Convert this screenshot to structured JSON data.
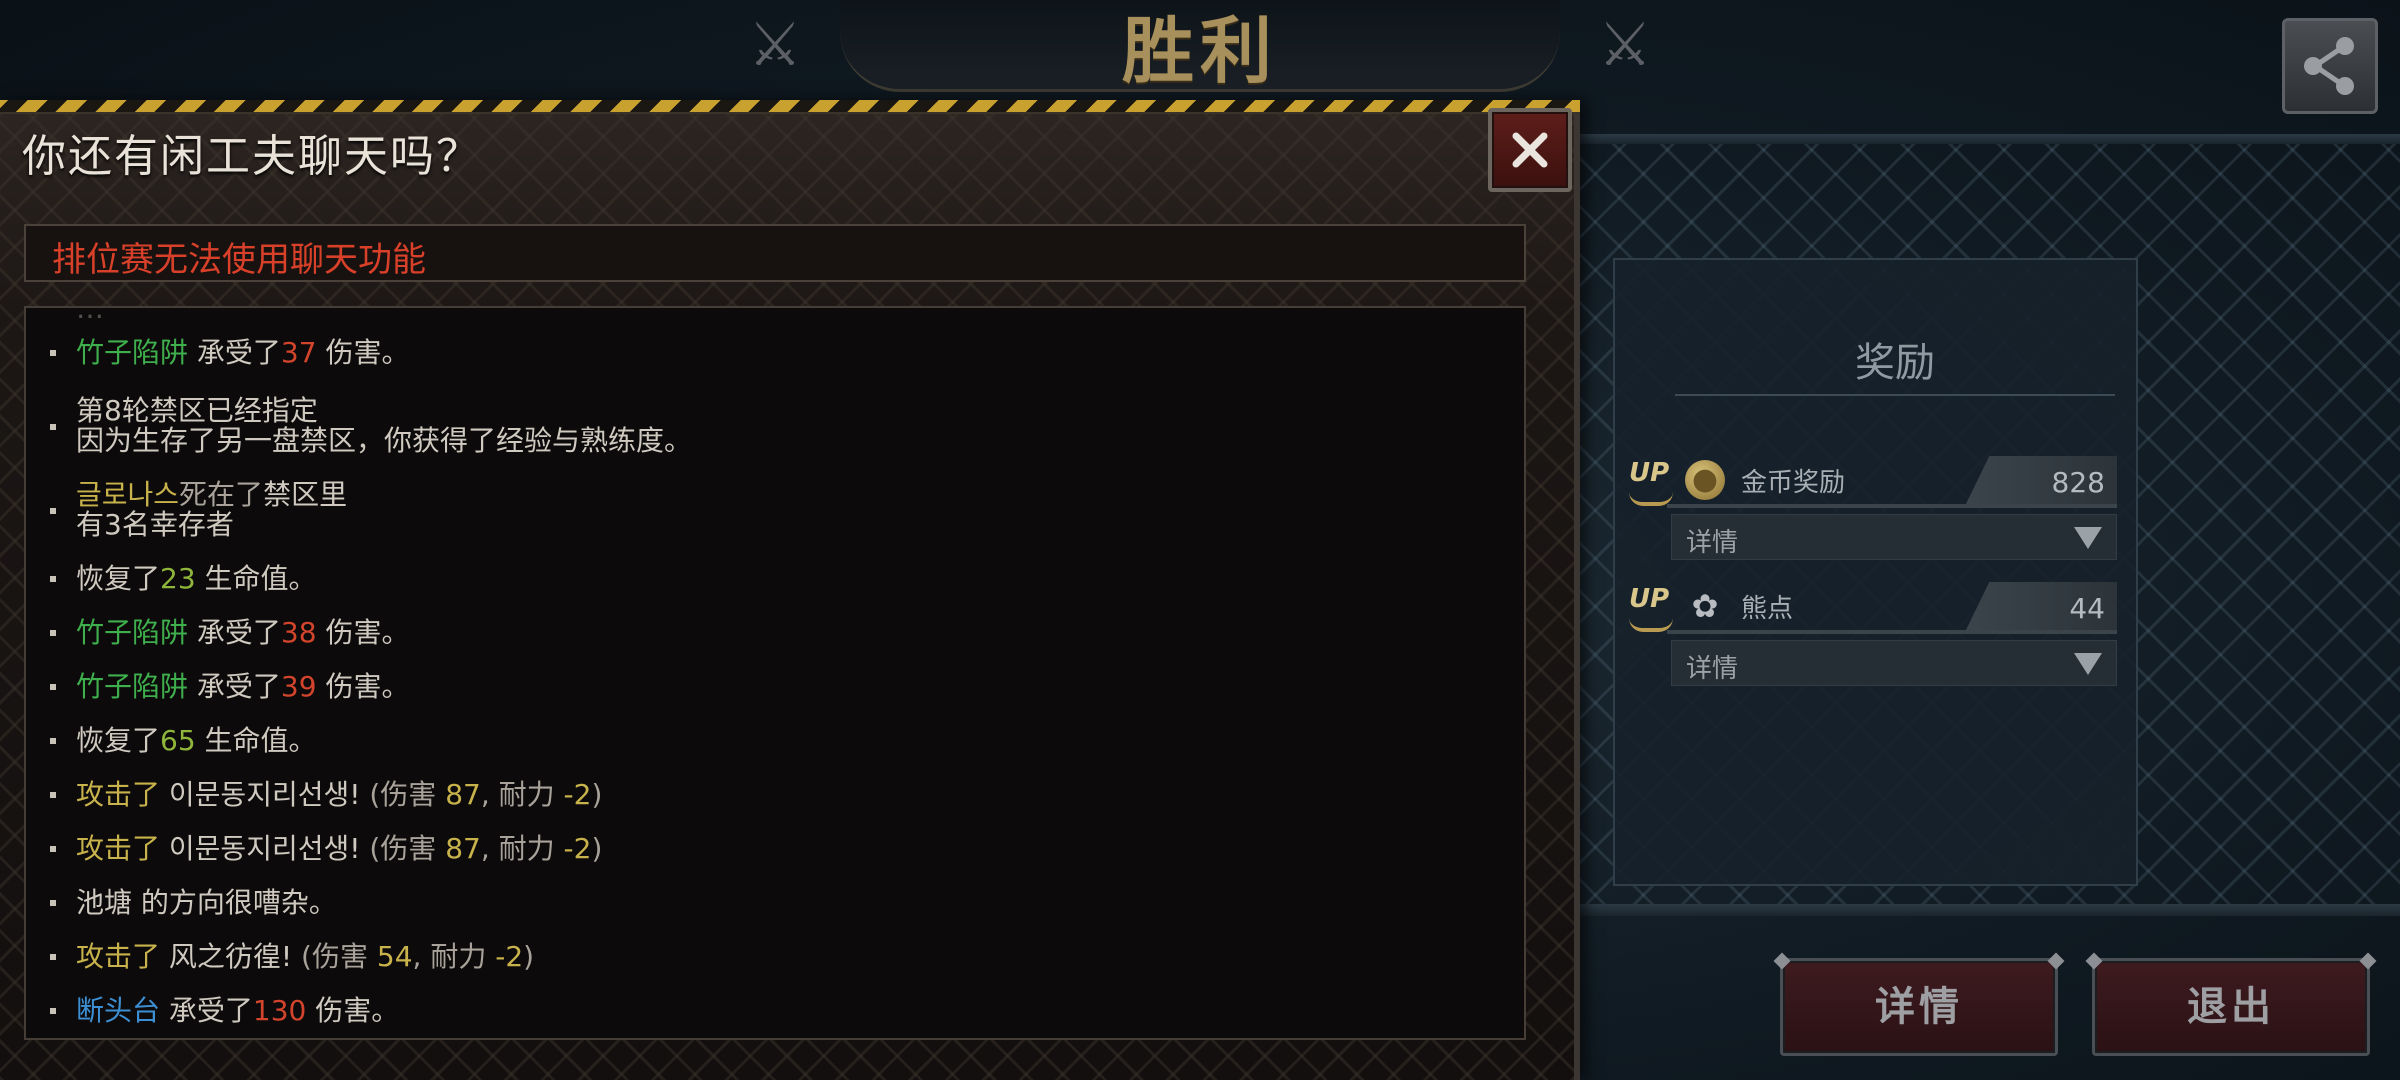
{
  "victory_title": "胜利",
  "chat_dialog": {
    "title": "你还有闲工夫聊天吗？",
    "notice": "排位赛无法使用聊天功能",
    "close_label": "✕"
  },
  "log_cutoff_text": "…",
  "log": [
    {
      "who": "竹子陷阱",
      "mid": " 承受了",
      "num": "37",
      "end": " 伤害。"
    },
    {
      "line1": "第8轮禁区已经指定",
      "line2": "因为生存了另一盘禁区，你获得了经验与熟练度。"
    },
    {
      "who": "글로나스",
      "mid": "死在了",
      "end": "禁区里",
      "line2": "有3名幸存者"
    },
    {
      "pre": "恢复了",
      "num": "23",
      "end": " 生命值。"
    },
    {
      "who": "竹子陷阱",
      "mid": " 承受了",
      "num": "38",
      "end": " 伤害。"
    },
    {
      "who": "竹子陷阱",
      "mid": " 承受了",
      "num": "39",
      "end": " 伤害。"
    },
    {
      "pre": "恢复了",
      "num": "65",
      "end": " 生命值。"
    },
    {
      "act": "攻击了",
      "target": " 이문동지리선생!",
      "p1": " (伤害 ",
      "dmg": "87",
      "p2": ",  耐力  ",
      "dur": "-2",
      "p3": ")"
    },
    {
      "act": "攻击了",
      "target": " 이문동지리선생!",
      "p1": " (伤害 ",
      "dmg": "87",
      "p2": ",  耐力  ",
      "dur": "-2",
      "p3": ")"
    },
    {
      "pre": "池塘 的方向很嘈杂。"
    },
    {
      "act": "攻击了",
      "target": " 风之彷徨!",
      "p1": " (伤害 ",
      "dmg": "54",
      "p2": ",  耐力  ",
      "dur": "-2",
      "p3": ")"
    },
    {
      "who": "断头台",
      "mid": " 承受了",
      "num": "130",
      "end": " 伤害。"
    }
  ],
  "rewards": {
    "title": "奖励",
    "items": [
      {
        "badge": "UP",
        "icon": "coin-icon",
        "label": "金币奖励",
        "value": "828",
        "dropdown": "详情"
      },
      {
        "badge": "UP",
        "icon": "bear-paw-icon",
        "label": "熊点",
        "value": "44",
        "dropdown": "详情"
      }
    ]
  },
  "buttons": {
    "details": "详情",
    "exit": "退出"
  },
  "colors": {
    "trap_name": "#3fae4c",
    "damage": "#d2442b",
    "heal": "#8fb63a",
    "attack": "#c8b24c",
    "guillotine": "#3d8fd4",
    "notice": "#d8402a",
    "victory": "#a8905c"
  }
}
